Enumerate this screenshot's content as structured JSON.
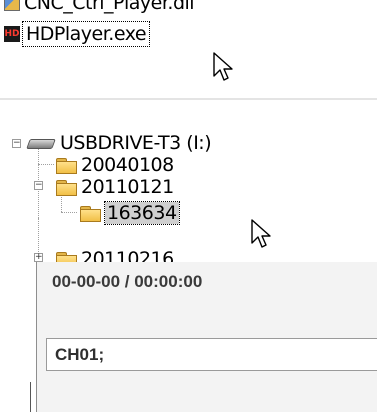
{
  "file_list": {
    "items": [
      {
        "name": "CNC_Ctrl_Player.dll",
        "icon": "dll-file-icon"
      },
      {
        "name": "HDPlayer.exe",
        "icon": "hdplayer-app-icon",
        "icon_text": "HD"
      }
    ]
  },
  "tree": {
    "drive": {
      "label": "USBDRIVE-T3 (I:)",
      "icon": "usb-drive-icon"
    },
    "folders": [
      {
        "label": "20040108",
        "expander": ""
      },
      {
        "label": "20110121",
        "expander": "−"
      },
      {
        "label": "163634",
        "selected": true
      },
      {
        "label": "20110216",
        "expander": "+"
      }
    ]
  },
  "player": {
    "time": "00-00-00 / 00:00:00",
    "channel": "CH01;"
  },
  "colors": {
    "folder": "#f1bf47",
    "selection": "#cfcfcf",
    "hd_icon_text": "#ff3b30"
  }
}
